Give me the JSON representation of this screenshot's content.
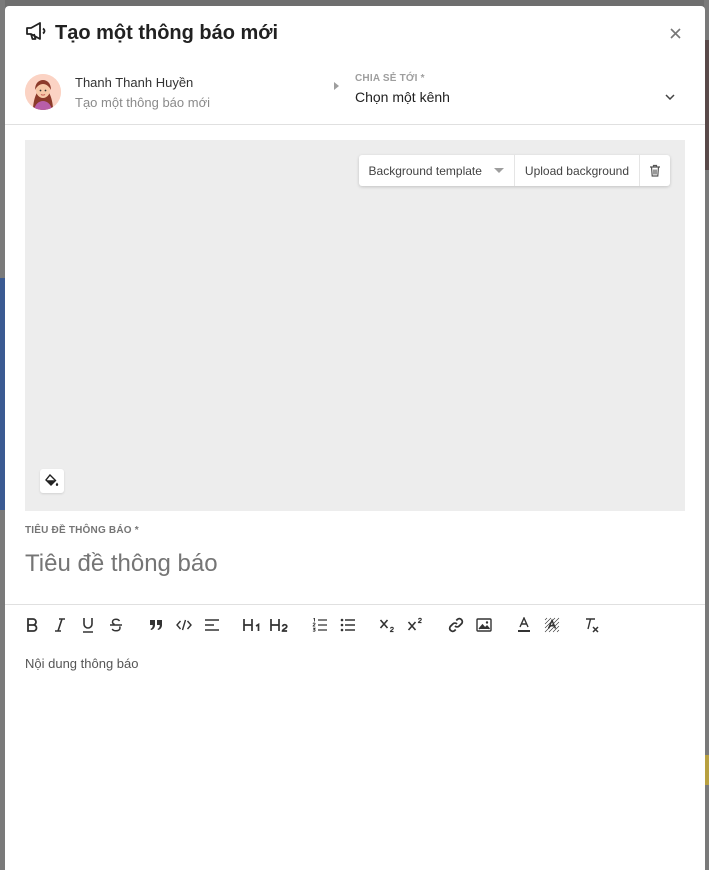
{
  "modal": {
    "title": "Tạo một thông báo mới",
    "icon": "megaphone-icon"
  },
  "author": {
    "name": "Thanh Thanh Huyền",
    "subtitle": "Tạo một thông báo mới"
  },
  "share": {
    "label": "CHIA SẺ TỚI *",
    "selected": "Chọn một kênh"
  },
  "background": {
    "template_label": "Background template",
    "upload_label": "Upload background"
  },
  "title_field": {
    "label": "TIÊU ĐỀ THÔNG BÁO *",
    "placeholder": "Tiêu đề thông báo"
  },
  "editor": {
    "placeholder": "Nội dung thông báo",
    "toolbar": [
      "bold",
      "italic",
      "underline",
      "strikethrough",
      "quote",
      "code",
      "align",
      "h1",
      "h2",
      "ordered-list",
      "bullet-list",
      "subscript",
      "superscript",
      "link",
      "image",
      "text-color",
      "background-color",
      "clear-format"
    ]
  },
  "colors": {
    "modal_bg": "#ffffff",
    "overlay": "#6e6e6e",
    "background_area": "#ededed"
  }
}
